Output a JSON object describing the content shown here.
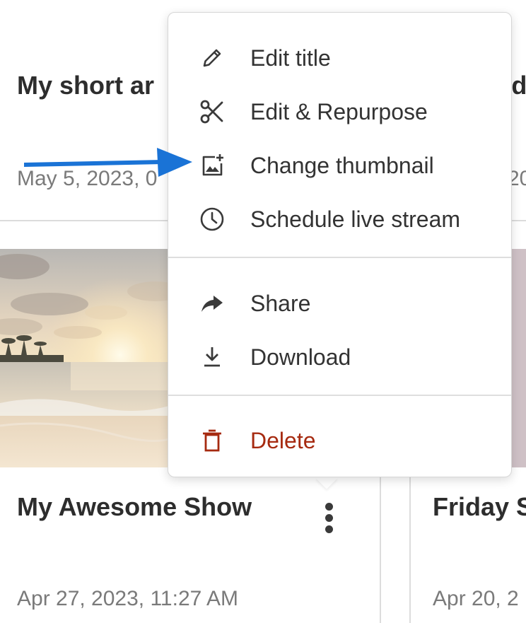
{
  "cards_top": [
    {
      "title": "My short ar",
      "date": "May 5, 2023, 0"
    },
    {
      "title": "Vid",
      "date": "20"
    }
  ],
  "cards_bottom": [
    {
      "title": "My Awesome Show",
      "date": "Apr 27, 2023, 11:27 AM"
    },
    {
      "title": "Friday S",
      "date": "Apr 20, 2"
    }
  ],
  "menu": {
    "group1": [
      {
        "label": "Edit title",
        "icon": "pencil-icon"
      },
      {
        "label": "Edit & Repurpose",
        "icon": "scissors-icon"
      },
      {
        "label": "Change thumbnail",
        "icon": "image-add-icon"
      },
      {
        "label": "Schedule live stream",
        "icon": "clock-icon"
      }
    ],
    "group2": [
      {
        "label": "Share",
        "icon": "share-arrow-icon"
      },
      {
        "label": "Download",
        "icon": "download-icon"
      }
    ],
    "group3": [
      {
        "label": "Delete",
        "icon": "trash-icon"
      }
    ]
  },
  "colors": {
    "arrow": "#1a73d6",
    "danger": "#a62a10",
    "text": "#333333",
    "muted": "#7a7a7a"
  }
}
